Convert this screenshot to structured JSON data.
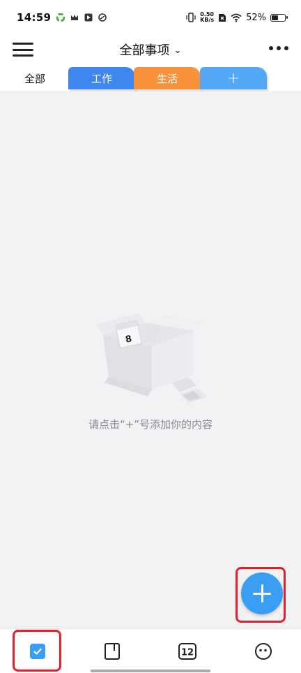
{
  "status_bar": {
    "time": "14:59",
    "net_speed_value": "0.50",
    "net_speed_unit": "KB/s",
    "battery_percent": "52%",
    "battery_level": 0.52
  },
  "header": {
    "title": "全部事项",
    "dropdown_glyph": "⌄"
  },
  "tabs": [
    {
      "label": "全部",
      "color": ""
    },
    {
      "label": "工作",
      "color": "#3f86ee"
    },
    {
      "label": "生活",
      "color": "#f9923c"
    },
    {
      "label": "+",
      "color": "#54a9f7"
    }
  ],
  "empty_state": {
    "message": "请点击“+”号添加你的内容",
    "illustration_day": "8"
  },
  "bottom_nav": {
    "calendar_day": "12"
  },
  "colors": {
    "accent": "#3a9ef3",
    "highlight": "#e0212b"
  },
  "icons": {
    "menu": "menu-icon",
    "more": "more-icon",
    "fab": "plus-icon",
    "nav": [
      "checkbox-icon",
      "notebook-icon",
      "calendar-icon",
      "face-icon"
    ]
  }
}
